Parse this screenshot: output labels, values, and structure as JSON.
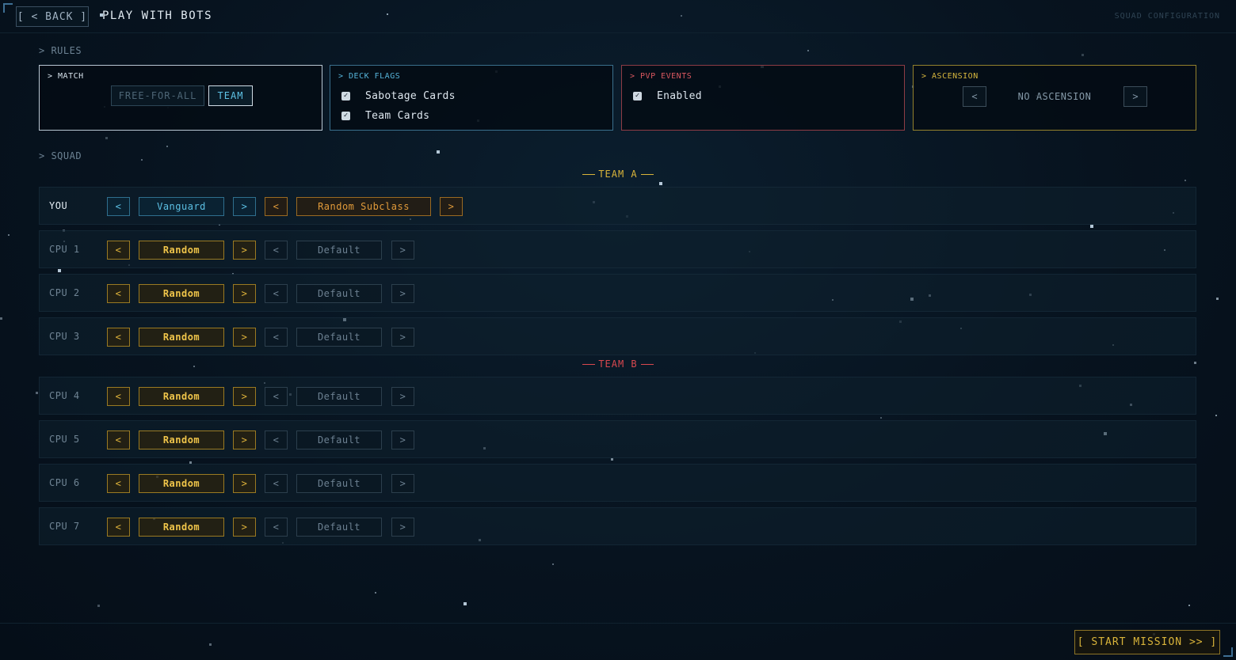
{
  "header": {
    "back_label": "[ < BACK ]",
    "title": "PLAY WITH BOTS",
    "right_caption": "SQUAD CONFIGURATION"
  },
  "rules": {
    "section_label": "> RULES",
    "match": {
      "title": "> MATCH",
      "options": [
        "FREE-FOR-ALL",
        "TEAM"
      ],
      "selected": "TEAM"
    },
    "deck_flags": {
      "title": "> DECK FLAGS",
      "items": [
        {
          "label": "Sabotage Cards",
          "checked": true
        },
        {
          "label": "Team Cards",
          "checked": true
        }
      ]
    },
    "pvp_events": {
      "title": "> PVP EVENTS",
      "items": [
        {
          "label": "Enabled",
          "checked": true
        }
      ]
    },
    "ascension": {
      "title": "> ASCENSION",
      "value": "NO ASCENSION",
      "prev": "<",
      "next": ">"
    }
  },
  "squad": {
    "section_label": "> SQUAD",
    "arrow_prev": "<",
    "arrow_next": ">",
    "teams": [
      {
        "name": "TEAM A",
        "members": [
          {
            "label": "YOU",
            "class": "Vanguard",
            "subclass": "Random Subclass"
          },
          {
            "label": "CPU 1",
            "class": "Random",
            "subclass": "Default"
          },
          {
            "label": "CPU 2",
            "class": "Random",
            "subclass": "Default"
          },
          {
            "label": "CPU 3",
            "class": "Random",
            "subclass": "Default"
          }
        ]
      },
      {
        "name": "TEAM B",
        "members": [
          {
            "label": "CPU 4",
            "class": "Random",
            "subclass": "Default"
          },
          {
            "label": "CPU 5",
            "class": "Random",
            "subclass": "Default"
          },
          {
            "label": "CPU 6",
            "class": "Random",
            "subclass": "Default"
          },
          {
            "label": "CPU 7",
            "class": "Random",
            "subclass": "Default"
          }
        ]
      }
    ]
  },
  "footer": {
    "start_label": "[ START MISSION >> ]"
  },
  "colors": {
    "background": "#06111c",
    "accent_blue": "#5cc0e4",
    "accent_gold": "#e0b43a",
    "team_a": "#d9b43a",
    "team_b": "#d9484f"
  }
}
